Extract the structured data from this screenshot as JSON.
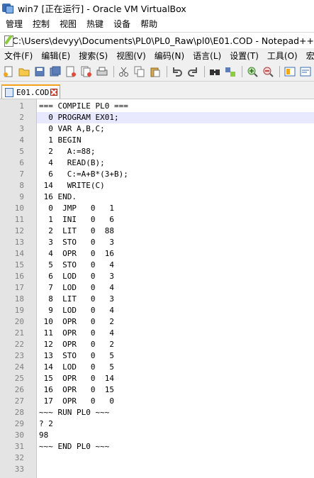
{
  "virtualbox": {
    "title": "win7 [正在运行] - Oracle VM VirtualBox",
    "menu": [
      "管理",
      "控制",
      "视图",
      "热键",
      "设备",
      "帮助"
    ]
  },
  "notepad": {
    "title": "C:\\Users\\devyy\\Documents\\PL0\\PL0_Raw\\pl0\\E01.COD - Notepad++",
    "menu": [
      "文件(F)",
      "编辑(E)",
      "搜索(S)",
      "视图(V)",
      "编码(N)",
      "语言(L)",
      "设置(T)",
      "工具(O)",
      "宏"
    ],
    "tab": {
      "label": "E01.COD"
    },
    "current_line": 2,
    "lines": [
      "=== COMPILE PL0 ===",
      "  0 PROGRAM EX01;",
      "  0 VAR A,B,C;",
      "  1 BEGIN",
      "  2   A:=88;",
      "  4   READ(B);",
      "  6   C:=A+B*(3+B);",
      " 14   WRITE(C)",
      " 16 END.",
      "  0  JMP   0   1",
      "  1  INI   0   6",
      "  2  LIT   0  88",
      "  3  STO   0   3",
      "  4  OPR   0  16",
      "  5  STO   0   4",
      "  6  LOD   0   3",
      "  7  LOD   0   4",
      "  8  LIT   0   3",
      "  9  LOD   0   4",
      " 10  OPR   0   2",
      " 11  OPR   0   4",
      " 12  OPR   0   2",
      " 13  STO   0   5",
      " 14  LOD   0   5",
      " 15  OPR   0  14",
      " 16  OPR   0  15",
      " 17  OPR   0   0",
      "~~~ RUN PL0 ~~~",
      "? 2",
      "98",
      "~~~ END PL0 ~~~",
      "",
      ""
    ]
  }
}
